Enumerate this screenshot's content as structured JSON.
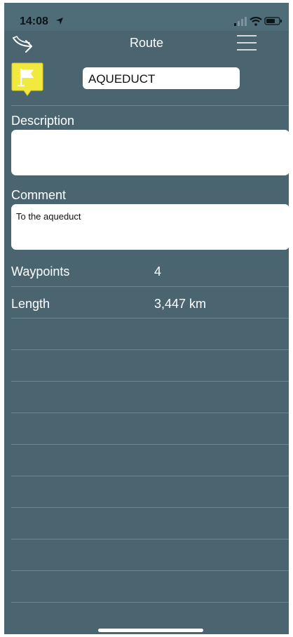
{
  "status": {
    "time": "14:08"
  },
  "nav": {
    "title": "Route"
  },
  "route": {
    "name": "AQUEDUCT",
    "description_label": "Description",
    "description_value": "",
    "comment_label": "Comment",
    "comment_value": "To the aqueduct",
    "waypoints_label": "Waypoints",
    "waypoints_value": "4",
    "length_label": "Length",
    "length_value": "3,447 km"
  },
  "icons": {
    "forward": "forward-arrow-icon",
    "menu": "hamburger-menu-icon",
    "flag": "flag-marker-icon"
  },
  "colors": {
    "background": "#4a6570",
    "flag": "#f2e93e",
    "text": "#ffffff"
  }
}
